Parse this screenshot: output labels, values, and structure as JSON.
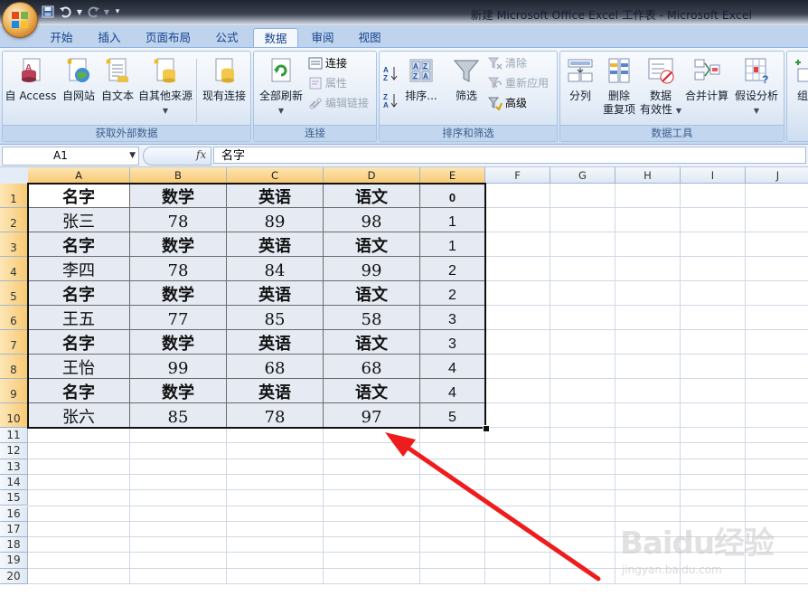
{
  "window": {
    "title": "新建 Microsoft Office Excel 工作表 - Microsoft Excel"
  },
  "ribbon_tabs": [
    "开始",
    "插入",
    "页面布局",
    "公式",
    "数据",
    "审阅",
    "视图"
  ],
  "active_tab": "数据",
  "groups": {
    "external_data": {
      "label": "获取外部数据",
      "buttons": [
        "自 Access",
        "自网站",
        "自文本",
        "自其他来源",
        "现有连接"
      ]
    },
    "connections": {
      "label": "连接",
      "refresh_all": "全部刷新",
      "small": [
        "连接",
        "属性",
        "编辑链接"
      ]
    },
    "sort_filter": {
      "label": "排序和筛选",
      "sort": "排序...",
      "filter": "筛选",
      "small": [
        "清除",
        "重新应用",
        "高级"
      ]
    },
    "data_tools": {
      "label": "数据工具",
      "split": "分列",
      "remove_dup_1": "删除",
      "remove_dup_2": "重复项",
      "validation_1": "数据",
      "validation_2": "有效性",
      "consolidate": "合并计算",
      "whatif": "假设分析"
    },
    "outline": {
      "partial_label": "组"
    }
  },
  "formula_bar": {
    "name_box": "A1",
    "fx_label": "fx",
    "content": "名字"
  },
  "columns": [
    "A",
    "B",
    "C",
    "D",
    "E",
    "F",
    "G",
    "H",
    "I",
    "J"
  ],
  "rows": [
    "1",
    "2",
    "3",
    "4",
    "5",
    "6",
    "7",
    "8",
    "9",
    "10",
    "11",
    "12",
    "13",
    "14",
    "15",
    "16",
    "17",
    "18",
    "19",
    "20"
  ],
  "table": [
    [
      "名字",
      "数学",
      "英语",
      "语文",
      "0"
    ],
    [
      "张三",
      "78",
      "89",
      "98",
      "1"
    ],
    [
      "名字",
      "数学",
      "英语",
      "语文",
      "1"
    ],
    [
      "李四",
      "78",
      "84",
      "99",
      "2"
    ],
    [
      "名字",
      "数学",
      "英语",
      "语文",
      "2"
    ],
    [
      "王五",
      "77",
      "85",
      "58",
      "3"
    ],
    [
      "名字",
      "数学",
      "英语",
      "语文",
      "3"
    ],
    [
      "王怡",
      "99",
      "68",
      "68",
      "4"
    ],
    [
      "名字",
      "数学",
      "英语",
      "语文",
      "4"
    ],
    [
      "张六",
      "85",
      "78",
      "97",
      "5"
    ]
  ],
  "watermark": {
    "logo": "Baidu经验",
    "url": "jingyan.baidu.com"
  },
  "colors": {
    "accent": "#15428b",
    "selection_header": "#f8c973",
    "annotation_arrow": "#ee1c1c"
  }
}
